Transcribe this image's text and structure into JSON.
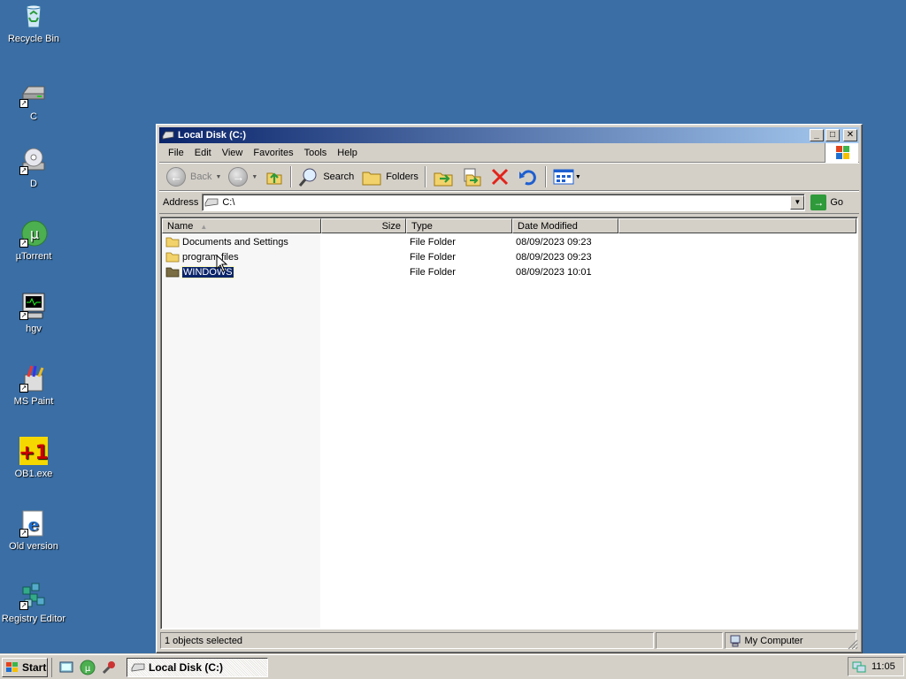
{
  "desktop": {
    "icons": [
      {
        "label": "Recycle Bin",
        "icon": "recycle-bin-icon"
      },
      {
        "label": "C",
        "icon": "hard-drive-icon"
      },
      {
        "label": "D",
        "icon": "cd-drive-icon"
      },
      {
        "label": "µTorrent",
        "icon": "utorrent-icon"
      },
      {
        "label": "hgv",
        "icon": "monitor-icon"
      },
      {
        "label": "MS Paint",
        "icon": "paint-icon"
      },
      {
        "label": "OB1.exe",
        "icon": "ob1-icon"
      },
      {
        "label": "Old version",
        "icon": "internet-explorer-icon"
      },
      {
        "label": "Registry Editor",
        "icon": "registry-editor-icon"
      }
    ],
    "background_color": "#3a6ea5"
  },
  "window": {
    "title": "Local Disk (C:)",
    "menu": [
      "File",
      "Edit",
      "View",
      "Favorites",
      "Tools",
      "Help"
    ],
    "toolbar": {
      "back": "Back",
      "search": "Search",
      "folders": "Folders"
    },
    "address": {
      "label": "Address",
      "value": "C:\\",
      "go": "Go"
    },
    "columns": [
      "Name",
      "Size",
      "Type",
      "Date Modified"
    ],
    "files": [
      {
        "name": "Documents and Settings",
        "size": "",
        "type": "File Folder",
        "modified": "08/09/2023 09:23"
      },
      {
        "name": "program files",
        "size": "",
        "type": "File Folder",
        "modified": "08/09/2023 09:23"
      },
      {
        "name": "WINDOWS",
        "size": "",
        "type": "File Folder",
        "modified": "08/09/2023 10:01"
      }
    ],
    "selected_file": "WINDOWS",
    "status": {
      "left": "1 objects selected",
      "middle": "",
      "zone": "My Computer"
    }
  },
  "taskbar": {
    "start": "Start",
    "tasks": [
      "Local Disk (C:)"
    ],
    "clock": "11:05"
  },
  "colors": {
    "title_active_start": "#0a246a",
    "title_active_end": "#a6caf0",
    "selection": "#0a246a",
    "face": "#d4d0c8"
  }
}
